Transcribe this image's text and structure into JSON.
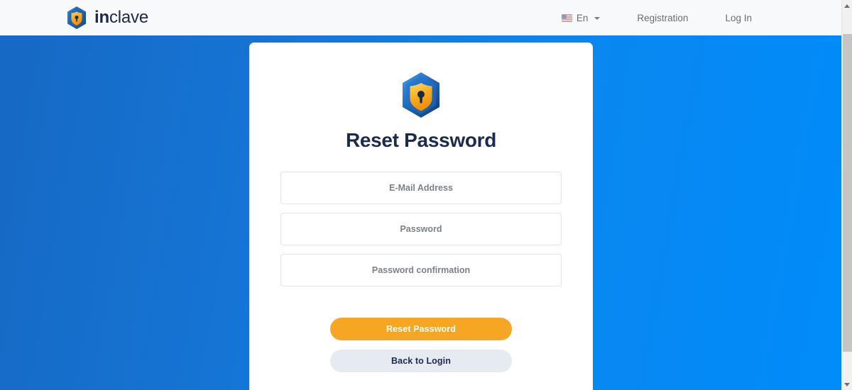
{
  "header": {
    "brand": {
      "logo_icon": "inclave-hexagon-shield-icon",
      "name_bold": "in",
      "name_light": "clave"
    },
    "nav": {
      "language": {
        "icon": "us-flag-icon",
        "label": "En",
        "caret_icon": "chevron-down-icon"
      },
      "registration_label": "Registration",
      "login_label": "Log In"
    }
  },
  "card": {
    "logo_icon": "inclave-hexagon-shield-icon",
    "title": "Reset Password",
    "fields": {
      "email_placeholder": "E-Mail Address",
      "email_value": "",
      "password_placeholder": "Password",
      "password_value": "",
      "password_confirm_placeholder": "Password confirmation",
      "password_confirm_value": ""
    },
    "buttons": {
      "submit_label": "Reset Password",
      "back_label": "Back to Login"
    }
  },
  "scrollbar": {
    "up_icon": "scroll-up-arrow-icon",
    "down_icon": "scroll-down-arrow-icon"
  },
  "colors": {
    "brand_navy": "#1c2a4e",
    "accent_orange": "#f6a623",
    "bg_blue_left": "#1669c4",
    "bg_blue_right": "#008cfa",
    "secondary_button": "#e6eaf1",
    "header_bg": "#f8f9fa"
  }
}
